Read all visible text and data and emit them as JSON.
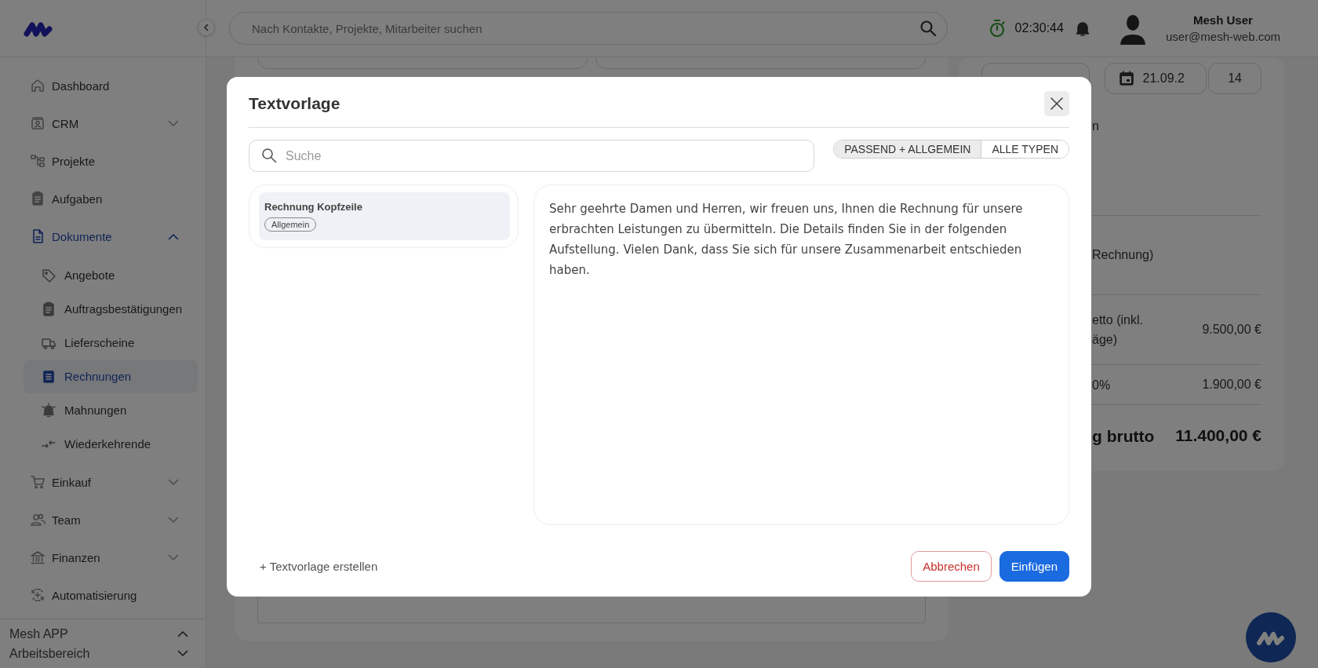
{
  "header": {
    "search": {
      "placeholder": "Nach Kontakte, Projekte, Mitarbeiter suchen"
    },
    "timer": "02:30:44",
    "user": {
      "name": "Mesh User",
      "email": "user@mesh-web.com"
    }
  },
  "sidebar": {
    "items": [
      {
        "label": "Dashboard",
        "selected": false
      },
      {
        "label": "CRM",
        "selected": false,
        "expanded": false
      },
      {
        "label": "Projekte",
        "selected": false
      },
      {
        "label": "Aufgaben",
        "selected": false
      },
      {
        "label": "Dokumente",
        "selected": false,
        "expanded": true,
        "children": [
          {
            "label": "Angebote",
            "selected": false
          },
          {
            "label": "Auftragsbestätigungen",
            "selected": false
          },
          {
            "label": "Lieferscheine",
            "selected": false
          },
          {
            "label": "Rechnungen",
            "selected": true
          },
          {
            "label": "Mahnungen",
            "selected": false
          },
          {
            "label": "Wiederkehrende",
            "selected": false
          }
        ]
      },
      {
        "label": "Einkauf",
        "selected": false,
        "expanded": false
      },
      {
        "label": "Team",
        "selected": false,
        "expanded": false
      },
      {
        "label": "Finanzen",
        "selected": false,
        "expanded": false
      },
      {
        "label": "Automatisierung",
        "selected": false
      }
    ],
    "footer": [
      {
        "label": "Mesh APP",
        "expanded": true
      },
      {
        "label": "Arbeitsbereich",
        "expanded": false
      }
    ]
  },
  "summary_panel": {
    "due_date": "21.09.2",
    "days": "14",
    "rows": [
      {
        "label": "n"
      },
      {
        "label": "Rechnung)"
      },
      {
        "label": "etto (inkl. äge)",
        "value": "9.500,00 €"
      },
      {
        "label": "0%",
        "value": "1.900,00 €"
      },
      {
        "label": "g brutto",
        "value": "11.400,00 €",
        "kind": "total"
      }
    ]
  },
  "modal": {
    "title": "Textvorlage",
    "search": {
      "placeholder": "Suche"
    },
    "filters": [
      {
        "label": "PASSEND + ALLGEMEIN",
        "selected": true
      },
      {
        "label": "ALLE TYPEN",
        "selected": false
      }
    ],
    "templates": [
      {
        "name": "Rechnung Kopfzeile",
        "tag": "Allgemein",
        "selected": true
      }
    ],
    "preview": "Sehr geehrte Damen und Herren, wir freuen uns, Ihnen die Rechnung für unsere erbrachten Leistungen zu übermitteln. Die Details finden Sie in der folgenden Aufstellung. Vielen Dank, dass Sie sich für unsere Zusammenarbeit entschieden haben.",
    "create_link": "+ Textvorlage erstellen",
    "buttons": [
      {
        "label": "Abbrechen",
        "kind": "cancel"
      },
      {
        "label": "Einfügen",
        "kind": "primary"
      }
    ]
  }
}
